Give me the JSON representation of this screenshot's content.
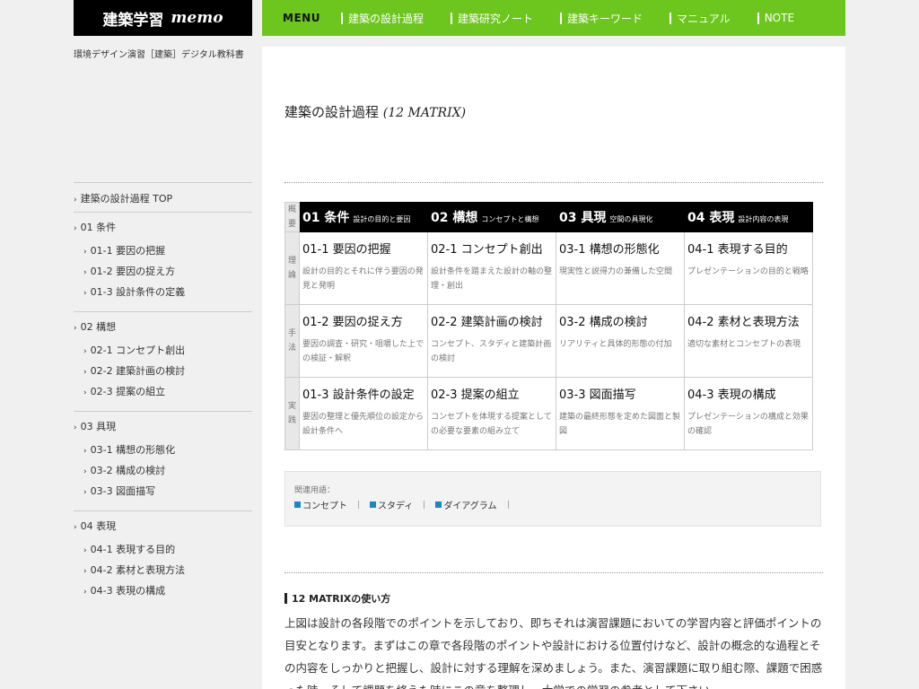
{
  "header": {
    "logo_main": "建築学習",
    "logo_sub": "memo",
    "menu_label": "MENU",
    "nav_items": [
      "建築の設計過程",
      "建築研究ノート",
      "建築キーワード",
      "マニュアル",
      "NOTE"
    ]
  },
  "tagline": "環境デザイン演習［建築］デジタル教科書",
  "sidebar": {
    "top": "建築の設計過程 TOP",
    "sections": [
      {
        "label": "01 条件",
        "items": [
          "01-1 要因の把握",
          "01-2 要因の捉え方",
          "01-3 設計条件の定義"
        ]
      },
      {
        "label": "02 構想",
        "items": [
          "02-1 コンセプト創出",
          "02-2 建築計画の検討",
          "02-3 提案の組立"
        ]
      },
      {
        "label": "03 具現",
        "items": [
          "03-1 構想の形態化",
          "03-2 構成の検討",
          "03-3 図面描写"
        ]
      },
      {
        "label": "04 表現",
        "items": [
          "04-1 表現する目的",
          "04-2 素材と表現方法",
          "04-3 表現の構成"
        ]
      }
    ]
  },
  "main": {
    "title": "建築の設計過程",
    "title_sub": "(12 MATRIX)",
    "matrix": {
      "corner": "概要",
      "columns": [
        {
          "num": "01 条件",
          "desc": "設計の目的と要因"
        },
        {
          "num": "02 構想",
          "desc": "コンセプトと構想"
        },
        {
          "num": "03 具現",
          "desc": "空間の具現化"
        },
        {
          "num": "04 表現",
          "desc": "設計内容の表現"
        }
      ],
      "rows": [
        {
          "label": "理論",
          "cells": [
            {
              "title": "01-1 要因の把握",
              "desc": "設計の目的とそれに伴う要因の発見と発明"
            },
            {
              "title": "02-1 コンセプト創出",
              "desc": "設計条件を踏まえた設計の軸の整理・創出"
            },
            {
              "title": "03-1 構想の形態化",
              "desc": "現実性と説得力の兼備した空間"
            },
            {
              "title": "04-1 表現する目的",
              "desc": "プレゼンテーションの目的と戦略"
            }
          ]
        },
        {
          "label": "手法",
          "cells": [
            {
              "title": "01-2 要因の捉え方",
              "desc": "要因の調査・研究・咀嚼した上での検証・解釈"
            },
            {
              "title": "02-2 建築計画の検討",
              "desc": "コンセプト、スタディと建築計画の検討"
            },
            {
              "title": "03-2 構成の検討",
              "desc": "リアリティと具体的形態の付加"
            },
            {
              "title": "04-2 素材と表現方法",
              "desc": "適切な素材とコンセプトの表現"
            }
          ]
        },
        {
          "label": "実践",
          "cells": [
            {
              "title": "01-3 設計条件の設定",
              "desc": "要因の整理と優先順位の設定から設計条件へ"
            },
            {
              "title": "02-3 提案の組立",
              "desc": "コンセプトを体現する提案としての必要な要素の組み立て"
            },
            {
              "title": "03-3 図面描写",
              "desc": "建築の最終形態を定めた図面と製図"
            },
            {
              "title": "04-3 表現の構成",
              "desc": "プレゼンテーションの構成と効果の確認"
            }
          ]
        }
      ]
    },
    "related": {
      "label": "関連用語：",
      "tags": [
        "コンセプト",
        "スタディ",
        "ダイアグラム"
      ]
    },
    "howto_title": "12 MATRIXの使い方",
    "body": "上図は設計の各段階でのポイントを示しており、即ちそれは演習課題においての学習内容と評価ポイントの目安となります。まずはこの章で各段階のポイントや設計における位置付けなど、設計の概念的な過程とその内容をしっかりと把握し、設計に対する理解を深めましょう。また、演習課題に取り組む際、課題で困惑った時、そして課題を終えた時にこの章を整理し、大学での学習の参考として下さい。"
  }
}
